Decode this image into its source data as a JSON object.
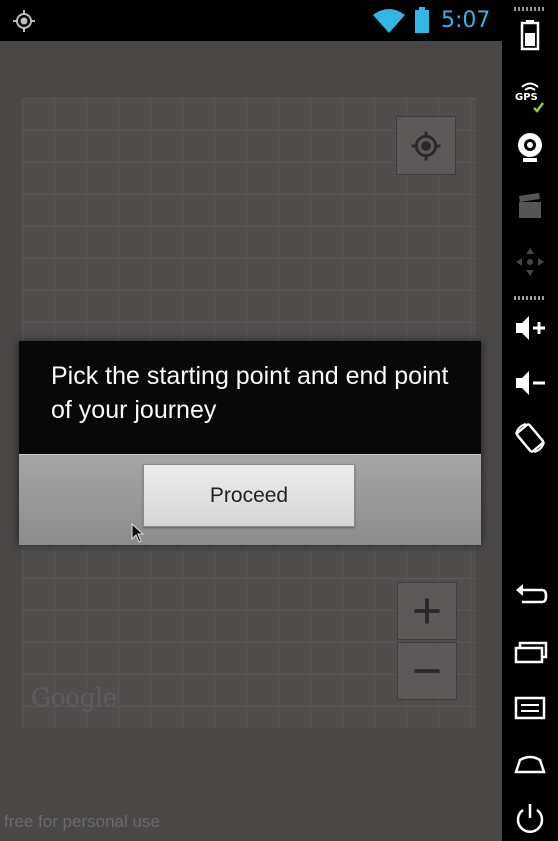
{
  "status_bar": {
    "time": "5:07",
    "icons": [
      "location-icon",
      "wifi-icon",
      "battery-icon"
    ],
    "accent_color": "#34b5e5"
  },
  "map": {
    "logo": "Google",
    "controls": [
      "my-location-icon",
      "zoom-in-icon",
      "zoom-out-icon"
    ]
  },
  "dialog": {
    "message": "Pick the starting point and end point of your journey",
    "proceed_label": "Proceed"
  },
  "emulator_controls": {
    "gps_label": "GPS",
    "icons": [
      "battery-icon",
      "gps-icon",
      "webcam-icon",
      "video-icon",
      "dpad-icon",
      "volume-up-icon",
      "volume-down-icon",
      "rotate-icon",
      "back-icon",
      "recent-apps-icon",
      "menu-icon",
      "home-icon",
      "power-icon"
    ]
  },
  "watermark": "free for personal use"
}
